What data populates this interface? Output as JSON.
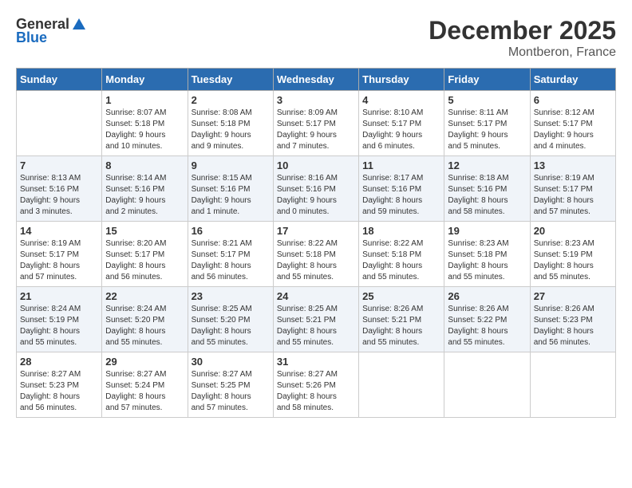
{
  "header": {
    "logo_general": "General",
    "logo_blue": "Blue",
    "month_title": "December 2025",
    "location": "Montberon, France"
  },
  "calendar": {
    "days_of_week": [
      "Sunday",
      "Monday",
      "Tuesday",
      "Wednesday",
      "Thursday",
      "Friday",
      "Saturday"
    ],
    "weeks": [
      [
        {
          "day": "",
          "info": ""
        },
        {
          "day": "1",
          "info": "Sunrise: 8:07 AM\nSunset: 5:18 PM\nDaylight: 9 hours\nand 10 minutes."
        },
        {
          "day": "2",
          "info": "Sunrise: 8:08 AM\nSunset: 5:18 PM\nDaylight: 9 hours\nand 9 minutes."
        },
        {
          "day": "3",
          "info": "Sunrise: 8:09 AM\nSunset: 5:17 PM\nDaylight: 9 hours\nand 7 minutes."
        },
        {
          "day": "4",
          "info": "Sunrise: 8:10 AM\nSunset: 5:17 PM\nDaylight: 9 hours\nand 6 minutes."
        },
        {
          "day": "5",
          "info": "Sunrise: 8:11 AM\nSunset: 5:17 PM\nDaylight: 9 hours\nand 5 minutes."
        },
        {
          "day": "6",
          "info": "Sunrise: 8:12 AM\nSunset: 5:17 PM\nDaylight: 9 hours\nand 4 minutes."
        }
      ],
      [
        {
          "day": "7",
          "info": "Sunrise: 8:13 AM\nSunset: 5:16 PM\nDaylight: 9 hours\nand 3 minutes."
        },
        {
          "day": "8",
          "info": "Sunrise: 8:14 AM\nSunset: 5:16 PM\nDaylight: 9 hours\nand 2 minutes."
        },
        {
          "day": "9",
          "info": "Sunrise: 8:15 AM\nSunset: 5:16 PM\nDaylight: 9 hours\nand 1 minute."
        },
        {
          "day": "10",
          "info": "Sunrise: 8:16 AM\nSunset: 5:16 PM\nDaylight: 9 hours\nand 0 minutes."
        },
        {
          "day": "11",
          "info": "Sunrise: 8:17 AM\nSunset: 5:16 PM\nDaylight: 8 hours\nand 59 minutes."
        },
        {
          "day": "12",
          "info": "Sunrise: 8:18 AM\nSunset: 5:16 PM\nDaylight: 8 hours\nand 58 minutes."
        },
        {
          "day": "13",
          "info": "Sunrise: 8:19 AM\nSunset: 5:17 PM\nDaylight: 8 hours\nand 57 minutes."
        }
      ],
      [
        {
          "day": "14",
          "info": "Sunrise: 8:19 AM\nSunset: 5:17 PM\nDaylight: 8 hours\nand 57 minutes."
        },
        {
          "day": "15",
          "info": "Sunrise: 8:20 AM\nSunset: 5:17 PM\nDaylight: 8 hours\nand 56 minutes."
        },
        {
          "day": "16",
          "info": "Sunrise: 8:21 AM\nSunset: 5:17 PM\nDaylight: 8 hours\nand 56 minutes."
        },
        {
          "day": "17",
          "info": "Sunrise: 8:22 AM\nSunset: 5:18 PM\nDaylight: 8 hours\nand 55 minutes."
        },
        {
          "day": "18",
          "info": "Sunrise: 8:22 AM\nSunset: 5:18 PM\nDaylight: 8 hours\nand 55 minutes."
        },
        {
          "day": "19",
          "info": "Sunrise: 8:23 AM\nSunset: 5:18 PM\nDaylight: 8 hours\nand 55 minutes."
        },
        {
          "day": "20",
          "info": "Sunrise: 8:23 AM\nSunset: 5:19 PM\nDaylight: 8 hours\nand 55 minutes."
        }
      ],
      [
        {
          "day": "21",
          "info": "Sunrise: 8:24 AM\nSunset: 5:19 PM\nDaylight: 8 hours\nand 55 minutes."
        },
        {
          "day": "22",
          "info": "Sunrise: 8:24 AM\nSunset: 5:20 PM\nDaylight: 8 hours\nand 55 minutes."
        },
        {
          "day": "23",
          "info": "Sunrise: 8:25 AM\nSunset: 5:20 PM\nDaylight: 8 hours\nand 55 minutes."
        },
        {
          "day": "24",
          "info": "Sunrise: 8:25 AM\nSunset: 5:21 PM\nDaylight: 8 hours\nand 55 minutes."
        },
        {
          "day": "25",
          "info": "Sunrise: 8:26 AM\nSunset: 5:21 PM\nDaylight: 8 hours\nand 55 minutes."
        },
        {
          "day": "26",
          "info": "Sunrise: 8:26 AM\nSunset: 5:22 PM\nDaylight: 8 hours\nand 55 minutes."
        },
        {
          "day": "27",
          "info": "Sunrise: 8:26 AM\nSunset: 5:23 PM\nDaylight: 8 hours\nand 56 minutes."
        }
      ],
      [
        {
          "day": "28",
          "info": "Sunrise: 8:27 AM\nSunset: 5:23 PM\nDaylight: 8 hours\nand 56 minutes."
        },
        {
          "day": "29",
          "info": "Sunrise: 8:27 AM\nSunset: 5:24 PM\nDaylight: 8 hours\nand 57 minutes."
        },
        {
          "day": "30",
          "info": "Sunrise: 8:27 AM\nSunset: 5:25 PM\nDaylight: 8 hours\nand 57 minutes."
        },
        {
          "day": "31",
          "info": "Sunrise: 8:27 AM\nSunset: 5:26 PM\nDaylight: 8 hours\nand 58 minutes."
        },
        {
          "day": "",
          "info": ""
        },
        {
          "day": "",
          "info": ""
        },
        {
          "day": "",
          "info": ""
        }
      ]
    ]
  }
}
